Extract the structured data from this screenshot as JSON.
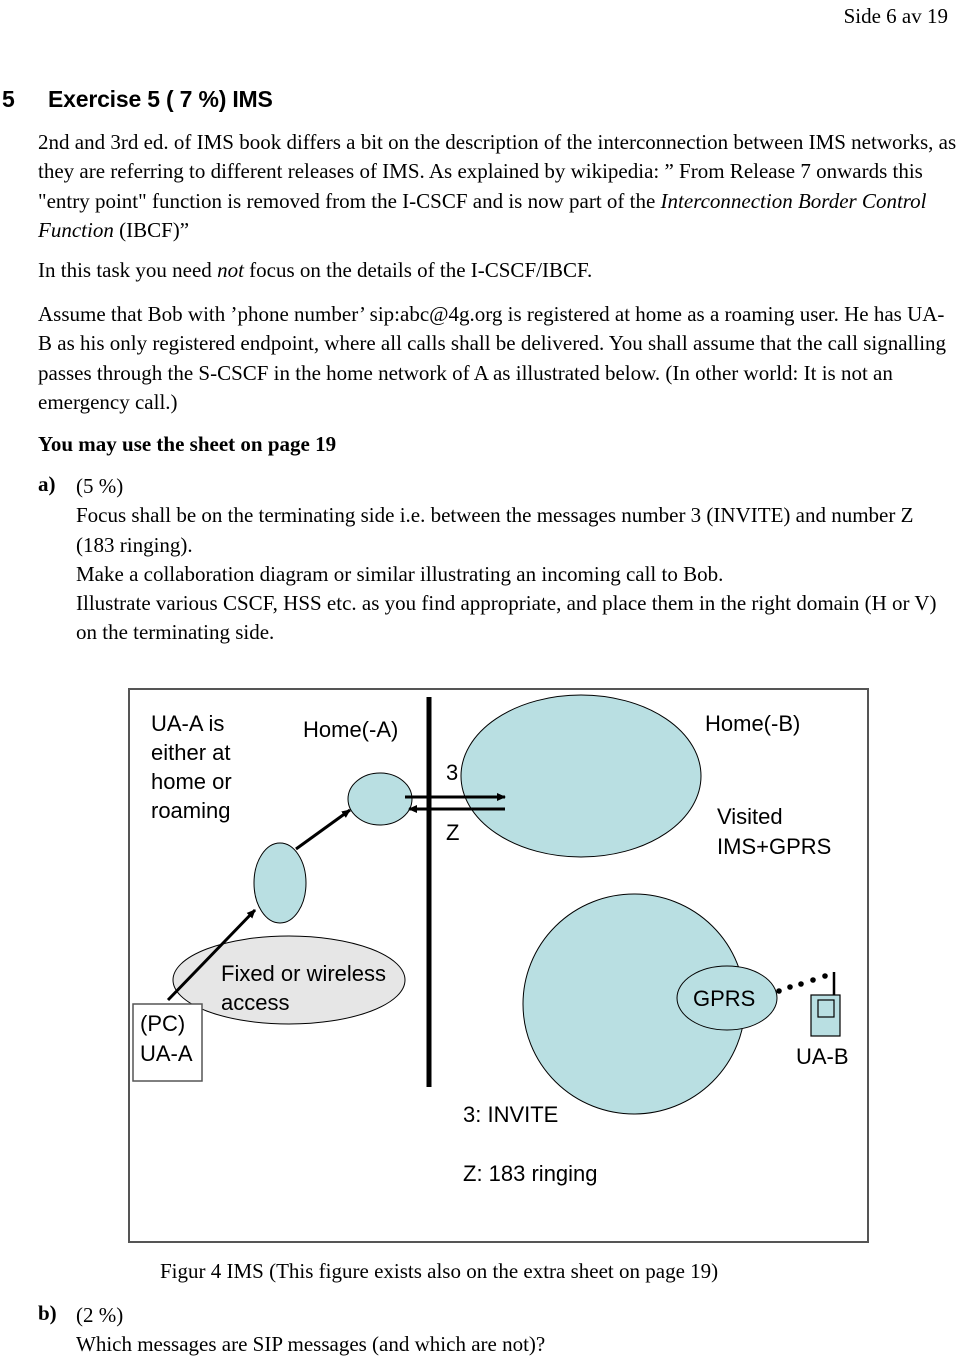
{
  "header": {
    "page_number": "Side 6 av 19"
  },
  "section": {
    "number": "5",
    "title": "Exercise 5 ( 7 %) IMS"
  },
  "intro": {
    "text_before_italic": "2nd and 3rd ed. of IMS book differs a bit on the description of the interconnection between IMS networks, as they are referring to different releases of IMS. As explained by wikipedia: ” From Release 7 onwards this \"entry point\" function is removed from the I-CSCF and is now part of the ",
    "italic": "Interconnection Border Control Function",
    "text_after_italic": " (IBCF)”"
  },
  "note": {
    "before": "In this task you need ",
    "italic": "not",
    "after": " focus on the details of the I-CSCF/IBCF."
  },
  "assumption": "Assume that Bob with ’phone number’ sip:abc@4g.org is registered at home as a roaming user. He has UA-B as his only registered endpoint, where all calls shall be delivered. You shall assume that the call signalling passes through the S-CSCF in the home network of A as illustrated below. (In other world: It is not an emergency call.)",
  "sheet_note": "You may use the sheet on page 19",
  "question_a": {
    "label": "a)",
    "weight": "(5 %)",
    "lines": [
      "Focus shall be on the terminating side i.e. between the messages number 3 (INVITE) and number Z (183 ringing).",
      "Make a collaboration diagram or similar illustrating an incoming call to Bob.",
      "Illustrate various CSCF, HSS etc. as you find appropriate, and place them in the right domain (H or V) on the terminating side."
    ]
  },
  "diagram": {
    "colors": {
      "node_fill": "#b9dfe2",
      "access_fill": "#e6e6e6",
      "stroke": "#000000",
      "frame": "#555555"
    },
    "ua_a_note": [
      "UA-A is",
      "either at",
      "home or",
      "roaming"
    ],
    "home_a_label": "Home(-A)",
    "home_b_label": "Home(-B)",
    "visited_label": [
      "Visited",
      "IMS+GPRS"
    ],
    "message_3": "3",
    "message_z": "Z",
    "access_label": [
      "Fixed or wireless",
      "access"
    ],
    "pc_label": [
      "(PC)",
      "UA-A"
    ],
    "gprs_label": "GPRS",
    "ua_b_label": "UA-B",
    "legend": [
      "3: INVITE",
      "Z: 183 ringing"
    ]
  },
  "figure_caption": "Figur 4 IMS (This figure exists also on the extra sheet on page 19)",
  "question_b": {
    "label": "b)",
    "weight": "(2 %)",
    "text": "Which messages are SIP messages (and which are not)?"
  }
}
